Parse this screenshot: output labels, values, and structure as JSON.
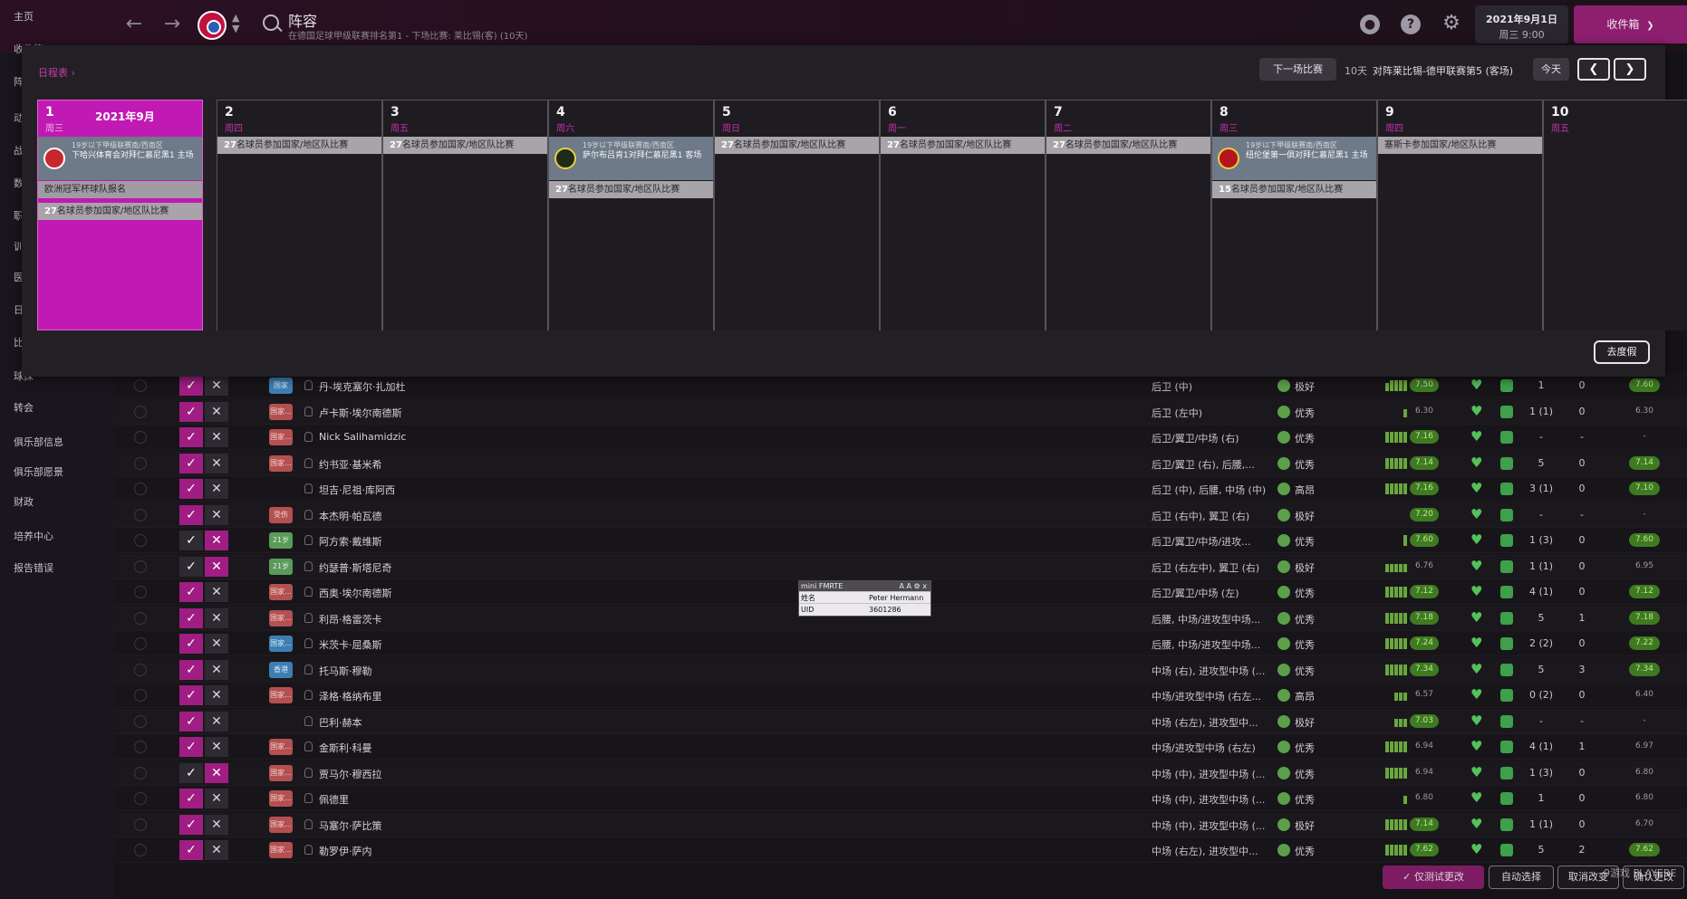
{
  "header": {
    "back_icon": "arrow-left-icon",
    "forward_icon": "arrow-right-icon",
    "title": "阵容",
    "subtitle": "在德国足球甲级联赛排名第1 - 下场比赛: 莱比锡(客) (10天)",
    "date": "2021年9月1日",
    "time": "周三 9:00",
    "inbox_label": "收件箱",
    "inbox_arrow": "❯",
    "help_glyph": "?",
    "gear_glyph": "⚙"
  },
  "sidebar": {
    "items": [
      "主页",
      "收件箱",
      "阵容",
      "动态",
      "战术",
      "数据",
      "职员",
      "训练",
      "医疗",
      "日程",
      "比赛",
      "球探",
      "转会",
      "俱乐部信息",
      "俱乐部愿景",
      "财政",
      "培养中心",
      "报告错误"
    ]
  },
  "calendar": {
    "schedule_link": "日程表",
    "next_match_label": "下一场比赛",
    "next_match_days": "10天",
    "next_match_desc": "对阵莱比锡-德甲联赛第5 (客场)",
    "today_label": "今天",
    "prev_glyph": "❮",
    "next_glyph": "❯",
    "holiday_label": "去度假",
    "month_label": "2021年9月",
    "today": {
      "day": "1",
      "weekday": "周三",
      "match": {
        "comp": "19岁以下甲级联赛南/西南区",
        "text": "下哈兴体育会对拜仁慕尼黑1 主场",
        "badge_color": "#c8272e"
      },
      "events": [
        {
          "bold": "",
          "text": "欧洲冠军杯球队报名"
        },
        {
          "bold": "27",
          "text": "名球员参加国家/地区队比赛"
        }
      ]
    },
    "days": [
      {
        "day": "2",
        "weekday": "周四",
        "bold": "27",
        "text": "名球员参加国家/地区队比赛"
      },
      {
        "day": "3",
        "weekday": "周五",
        "bold": "27",
        "text": "名球员参加国家/地区队比赛"
      },
      {
        "day": "4",
        "weekday": "周六",
        "match": {
          "comp": "19岁以下甲级联赛南/西南区",
          "text": "萨尔布吕肯1对拜仁慕尼黑1 客场",
          "badge_color": "#1e2a1a"
        },
        "bold": "27",
        "text": "名球员参加国家/地区队比赛"
      },
      {
        "day": "5",
        "weekday": "周日",
        "bold": "27",
        "text": "名球员参加国家/地区队比赛"
      },
      {
        "day": "6",
        "weekday": "周一",
        "bold": "27",
        "text": "名球员参加国家/地区队比赛"
      },
      {
        "day": "7",
        "weekday": "周二",
        "bold": "27",
        "text": "名球员参加国家/地区队比赛"
      },
      {
        "day": "8",
        "weekday": "周三",
        "match": {
          "comp": "19岁以下甲级联赛南/西南区",
          "text": "纽伦堡第一俱对拜仁慕尼黑1 主场",
          "badge_color": "#b4141e"
        },
        "bold": "15",
        "text": "名球员参加国家/地区队比赛"
      },
      {
        "day": "9",
        "weekday": "周四",
        "bold": "",
        "text": "塞斯卡参加国家/地区队比赛"
      },
      {
        "day": "10",
        "weekday": "周五",
        "bold": "",
        "text": ""
      }
    ]
  },
  "players": [
    {
      "name": "丹-埃克塞尔·扎加杜",
      "tag": "国家",
      "tag_style": "blue",
      "pos": "后卫 (中)",
      "cond": "极好",
      "form": [
        3,
        4,
        4,
        4,
        4
      ],
      "rating": "7.50",
      "apps": "1",
      "goals": "0",
      "avg": "7.60",
      "checked": true
    },
    {
      "name": "卢卡斯·埃尔南德斯",
      "tag": "国家...",
      "tag_style": "red",
      "pos": "后卫 (左中)",
      "cond": "优秀",
      "form": [
        0,
        0,
        0,
        0,
        3
      ],
      "rating": "6.30",
      "apps": "1 (1)",
      "goals": "0",
      "avg": "6.30",
      "checked": true
    },
    {
      "name": "Nick Salihamidzic",
      "tag": "国家...",
      "tag_style": "red",
      "pos": "后卫/翼卫/中场 (右)",
      "cond": "优秀",
      "form": [
        4,
        4,
        4,
        4,
        4
      ],
      "rating": "7.16",
      "apps": "-",
      "goals": "-",
      "avg": "-",
      "checked": true
    },
    {
      "name": "约书亚·基米希",
      "tag": "国家...",
      "tag_style": "red",
      "pos": "后卫/翼卫 (右), 后腰,...",
      "cond": "优秀",
      "form": [
        4,
        4,
        4,
        4,
        4
      ],
      "rating": "7.14",
      "apps": "5",
      "goals": "0",
      "avg": "7.14",
      "checked": true
    },
    {
      "name": "坦吉·尼祖·库阿西",
      "tag": "",
      "tag_style": "none",
      "pos": "后卫 (中), 后腰, 中场 (中)",
      "cond": "高昂",
      "form": [
        4,
        4,
        4,
        4,
        4
      ],
      "rating": "7.16",
      "apps": "3 (1)",
      "goals": "0",
      "avg": "7.10",
      "checked": true
    },
    {
      "name": "本杰明·帕瓦德",
      "tag": "受伤",
      "tag_style": "red",
      "pos": "后卫 (右中), 翼卫 (右)",
      "cond": "极好",
      "form": [
        0,
        0,
        0,
        0,
        0
      ],
      "rating": "7.20",
      "apps": "-",
      "goals": "-",
      "avg": "-",
      "checked": true
    },
    {
      "name": "阿方索·戴维斯",
      "tag": "21岁",
      "tag_style": "green",
      "pos": "后卫/翼卫/中场/进攻...",
      "cond": "优秀",
      "form": [
        0,
        0,
        0,
        0,
        4
      ],
      "rating": "7.60",
      "apps": "1 (3)",
      "goals": "0",
      "avg": "7.60",
      "checked": false
    },
    {
      "name": "约瑟普·斯塔尼奇",
      "tag": "21岁",
      "tag_style": "green",
      "pos": "后卫 (右左中), 翼卫 (右)",
      "cond": "极好",
      "form": [
        3,
        3,
        3,
        3,
        3
      ],
      "rating": "6.76",
      "apps": "1 (1)",
      "goals": "0",
      "avg": "6.95",
      "checked": false
    },
    {
      "name": "西奥·埃尔南德斯",
      "tag": "国家...",
      "tag_style": "red",
      "pos": "后卫/翼卫/中场 (左)",
      "cond": "优秀",
      "form": [
        4,
        4,
        4,
        4,
        4
      ],
      "rating": "7.12",
      "apps": "4 (1)",
      "goals": "0",
      "avg": "7.12",
      "checked": true
    },
    {
      "name": "利昂·格雷茨卡",
      "tag": "国家...",
      "tag_style": "red",
      "pos": "后腰, 中场/进攻型中场...",
      "cond": "优秀",
      "form": [
        4,
        4,
        4,
        4,
        4
      ],
      "rating": "7.18",
      "apps": "5",
      "goals": "1",
      "avg": "7.18",
      "checked": true
    },
    {
      "name": "米茨卡·屈桑斯",
      "tag": "国家...",
      "tag_style": "blue",
      "pos": "后腰, 中场/进攻型中场...",
      "cond": "优秀",
      "form": [
        4,
        4,
        4,
        4,
        4
      ],
      "rating": "7.24",
      "apps": "2 (2)",
      "goals": "0",
      "avg": "7.22",
      "checked": true
    },
    {
      "name": "托马斯·穆勒",
      "tag": "香港",
      "tag_style": "blue",
      "pos": "中场 (右), 进攻型中场 (...",
      "cond": "优秀",
      "form": [
        4,
        4,
        4,
        4,
        4
      ],
      "rating": "7.34",
      "apps": "5",
      "goals": "3",
      "avg": "7.34",
      "checked": true
    },
    {
      "name": "泽格·格纳布里",
      "tag": "国家...",
      "tag_style": "red",
      "pos": "中场/进攻型中场 (右左...",
      "cond": "高昂",
      "form": [
        0,
        0,
        3,
        3,
        3
      ],
      "rating": "6.57",
      "apps": "0 (2)",
      "goals": "0",
      "avg": "6.40",
      "checked": true
    },
    {
      "name": "巴利·赫本",
      "tag": "",
      "tag_style": "none",
      "pos": "中场 (右左), 进攻型中...",
      "cond": "极好",
      "form": [
        0,
        0,
        3,
        3,
        3
      ],
      "rating": "7.03",
      "apps": "-",
      "goals": "-",
      "avg": "-",
      "checked": true
    },
    {
      "name": "金斯利·科曼",
      "tag": "国家...",
      "tag_style": "red",
      "pos": "中场/进攻型中场 (右左)",
      "cond": "优秀",
      "form": [
        4,
        4,
        4,
        4,
        4
      ],
      "rating": "6.94",
      "apps": "4 (1)",
      "goals": "1",
      "avg": "6.97",
      "checked": true
    },
    {
      "name": "贾马尔·穆西拉",
      "tag": "国家...",
      "tag_style": "red",
      "pos": "中场 (中), 进攻型中场 (...",
      "cond": "优秀",
      "form": [
        4,
        4,
        4,
        4,
        4
      ],
      "rating": "6.94",
      "apps": "1 (3)",
      "goals": "0",
      "avg": "6.80",
      "checked": false
    },
    {
      "name": "佩德里",
      "tag": "国家...",
      "tag_style": "red",
      "pos": "中场 (中), 进攻型中场 (...",
      "cond": "优秀",
      "form": [
        0,
        0,
        0,
        0,
        3
      ],
      "rating": "6.80",
      "apps": "1",
      "goals": "0",
      "avg": "6.80",
      "checked": true
    },
    {
      "name": "马塞尔·萨比策",
      "tag": "国家...",
      "tag_style": "red",
      "pos": "中场 (中), 进攻型中场 (...",
      "cond": "极好",
      "form": [
        4,
        4,
        4,
        4,
        4
      ],
      "rating": "7.14",
      "apps": "1 (1)",
      "goals": "0",
      "avg": "6.70",
      "checked": true
    },
    {
      "name": "勒罗伊·萨内",
      "tag": "国家...",
      "tag_style": "red",
      "pos": "中场 (右左), 进攻型中...",
      "cond": "优秀",
      "form": [
        4,
        4,
        4,
        4,
        4
      ],
      "rating": "7.62",
      "apps": "5",
      "goals": "2",
      "avg": "7.62",
      "checked": true
    }
  ],
  "bottom": {
    "test_only_label": "✓ 仅测试更改",
    "auto_select_label": "自动选择",
    "cancel_label": "取消改变",
    "confirm_label": "确认更改"
  },
  "mini_fmrte": {
    "title": "mini FMRTE",
    "tools": "A A ⚙ x",
    "rows": [
      {
        "label": "姓名",
        "value": "Peter Hermann"
      },
      {
        "label": "UID",
        "value": "3601286"
      }
    ]
  },
  "watermark": "9游戏 PLAYERE"
}
